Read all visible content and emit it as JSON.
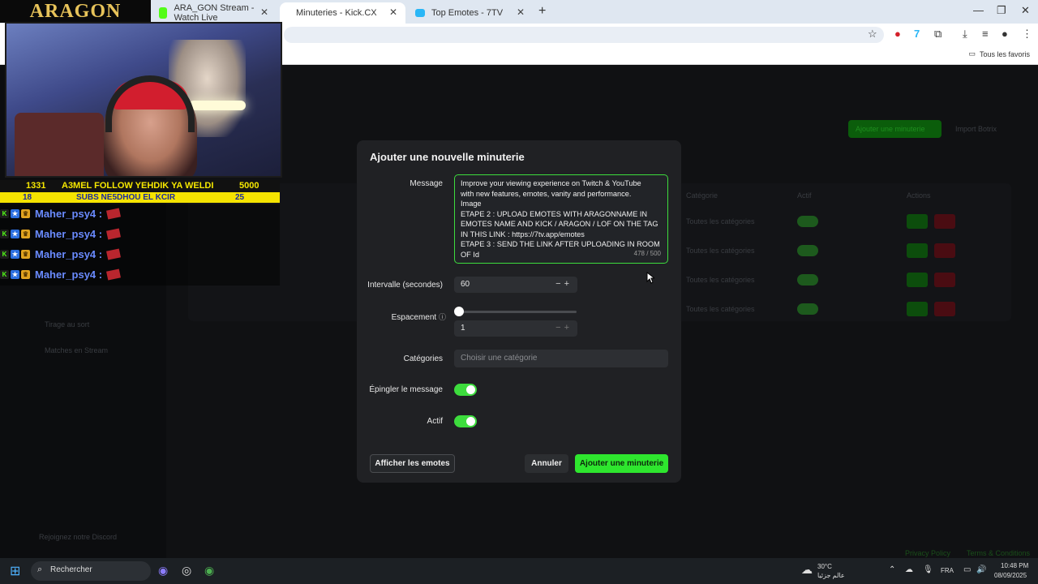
{
  "browser": {
    "tabs": [
      {
        "label": "ARA_GON Stream - Watch Live",
        "icon": "kick-icon"
      },
      {
        "label": "Minuteries - Kick.CX",
        "active": true
      },
      {
        "label": "Top Emotes - 7TV",
        "icon": "7tv-icon"
      }
    ],
    "bookmarks_label": "Tous les favoris"
  },
  "background_page": {
    "sidebar_items": [
      "Tirage au sort",
      "Matches en Stream"
    ],
    "sidebar_footer": "Rejoignez notre Discord",
    "table_columns": [
      "Catégorie",
      "Actif",
      "Actions"
    ],
    "table_category_value": "Toutes les catégories",
    "primary_action": "Ajouter une minuterie",
    "secondary_action": "Import Botrix",
    "footer_links": [
      "Privacy Policy",
      "Terms & Conditions"
    ]
  },
  "modal": {
    "title": "Ajouter une nouvelle minuterie",
    "message_label": "Message",
    "message_lines": [
      "Improve your viewing experience on Twitch & YouTube",
      "with new features, emotes, vanity and performance.",
      "Image",
      "ETAPE 2 : UPLOAD EMOTES WITH ARAGONNAME IN",
      "EMOTES NAME AND KICK / ARAGON / LOF ON THE TAG",
      "IN THIS LINK : https://7tv.app/emotes",
      "ETAPE 3 : SEND THE LINK AFTER UPLOADING IN ROOM",
      "OF Id"
    ],
    "message_counter": "478 / 500",
    "interval_label": "Intervalle (secondes)",
    "interval_value": "60",
    "spacing_label": "Espacement",
    "spacing_value": "1",
    "spacing_slider_level": 0,
    "categories_label": "Catégories",
    "categories_placeholder": "Choisir une catégorie",
    "pin_label": "Épingler le message",
    "pin_on": true,
    "active_label": "Actif",
    "active_on": true,
    "show_emotes_button": "Afficher les emotes",
    "cancel_button": "Annuler",
    "submit_button": "Ajouter une minuterie"
  },
  "overlay": {
    "logo": "ARAGON",
    "ticker_row1": {
      "left": "1331",
      "text": "A3MEL FOLLOW YEHDIK YA WELDI",
      "right": "5000"
    },
    "ticker_row2": {
      "left": "18",
      "text": "SUBS NE5DHOU EL KCIR",
      "right": "25"
    },
    "chat": [
      {
        "user": "Maher_psy4 :"
      },
      {
        "user": "Maher_psy4 :"
      },
      {
        "user": "Maher_psy4 :"
      },
      {
        "user": "Maher_psy4 :"
      }
    ]
  },
  "taskbar": {
    "search_label": "Rechercher",
    "weather_temp": "30°C",
    "weather_text": "عالم جزئيا",
    "language": "FRA",
    "time": "10:48 PM",
    "date": "08/09/2025"
  },
  "colors": {
    "accent_green": "#2ee62e",
    "modal_bg": "#202124",
    "ticker_yellow": "#f5e300"
  }
}
